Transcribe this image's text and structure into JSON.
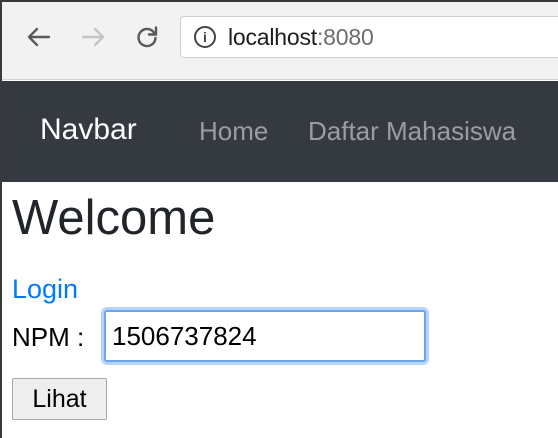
{
  "browser": {
    "url_host": "localhost",
    "url_port": ":8080",
    "icons": {
      "back": "back-arrow-icon",
      "forward": "forward-arrow-icon",
      "reload": "reload-icon",
      "info": "info-icon"
    }
  },
  "navbar": {
    "brand": "Navbar",
    "links": [
      {
        "label": "Home"
      },
      {
        "label": "Daftar Mahasiswa"
      }
    ],
    "background": "#343a40"
  },
  "main": {
    "heading": "Welcome",
    "login_link": "Login",
    "npm_label": "NPM :",
    "npm_value": "1506737824",
    "submit_label": "Lihat"
  },
  "colors": {
    "link": "#007bff",
    "focus_ring": "#6aa8ee"
  }
}
